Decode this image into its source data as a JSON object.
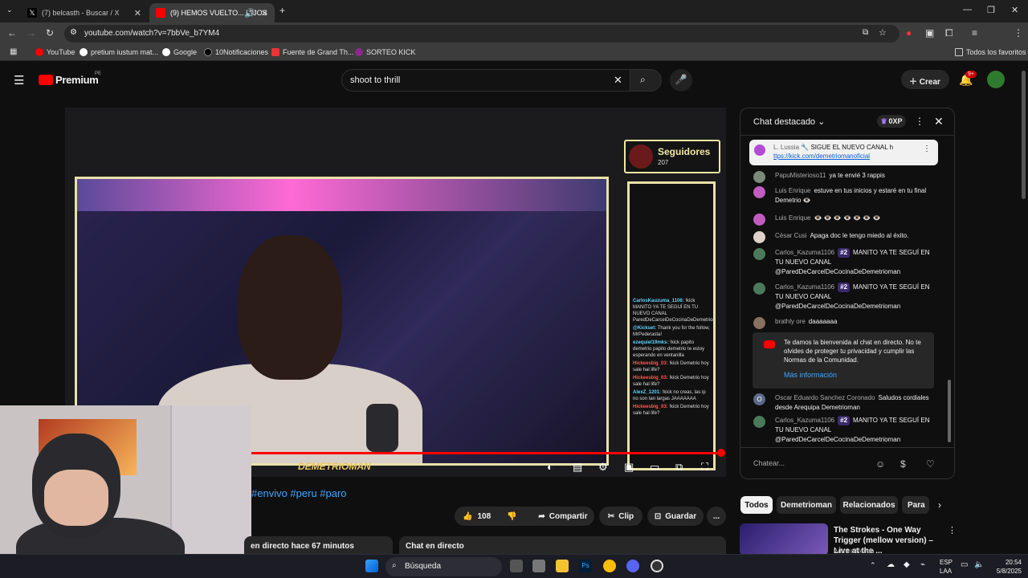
{
  "browser": {
    "tabs": [
      {
        "label": "(7) belcasth - Buscar / X",
        "active": false
      },
      {
        "label": "(9) HEMOS VUELTO... HIJOS",
        "active": true
      }
    ],
    "url": "youtube.com/watch?v=7bbVe_b7YM4",
    "bookmarks": [
      "YouTube",
      "pretium iustum mat...",
      "Google",
      "10Notificaciones",
      "Fuente de Grand Th...",
      "SORTEO KICK"
    ],
    "all_bookmarks": "Todos los favoritos"
  },
  "youtube": {
    "logo": "Premium",
    "logo_region": "PE",
    "search_value": "shoot to thrill",
    "create_label": "Crear",
    "notif_count": "9+"
  },
  "video": {
    "followers_label": "Seguidores",
    "followers_count": "207",
    "overlay_name": "DEMETRIOMAN",
    "mini_chat": [
      {
        "user": "CarlosKauzuma_1106:",
        "text": "!kick MANITO YA TE SEGUÍ EN TU NUEVO CANAL ParedDeCarcelDeCocinaDeDemetrioman"
      },
      {
        "user": "@Kickset:",
        "text": "Thank you for the follow, MrPederasta!"
      },
      {
        "user": "ezequiel19mks:",
        "text": "!kick papito demetrio papito demetrio te estoy esperando en ventanilla"
      },
      {
        "user": "Hickeesbig_03:",
        "text": "!kick Demetrio hoy sale hal life?"
      },
      {
        "user": "Hickeesbig_03:",
        "text": "!kick Demetrio hoy sale hal life?"
      },
      {
        "user": "AlexZ_1201:",
        "text": "!kick no creas, las ip no son tan largas JAAAAAAA"
      },
      {
        "user": "Hickeesbig_03:",
        "text": "!kick Demetrio hoy sale hal life?"
      }
    ]
  },
  "below_video": {
    "tags": "#envivo #peru #paro",
    "likes": "108",
    "share": "Compartir",
    "clip": "Clip",
    "save": "Guardar",
    "more": "...",
    "live_info": "en directo hace 67 minutos",
    "live_chat_card": "Chat en directo"
  },
  "chat": {
    "title": "Chat destacado",
    "xp": "0XP",
    "pinned": {
      "user": "L. Lussia",
      "text": "SIGUE EL NUEVO CANAL h",
      "link": "ttps://kick.com/demetriomanoficial"
    },
    "messages": [
      {
        "user": "PapuMisterioso11",
        "text": "ya te envié 3 rappis",
        "color": "#7a8a7a"
      },
      {
        "user": "Luis Enrique",
        "text": "estuve en tus inicios y estaré en tu final Demetrio 👁️",
        "color": "#c05cc0"
      },
      {
        "user": "Luis Enrique",
        "text": "👁️ 👁️ 👁️ 👁️ 👁️ 👁️ 👁️",
        "color": "#c05cc0"
      },
      {
        "user": "César Cusi",
        "text": "Apaga doc le tengo miedo al éxito.",
        "color": "#e0d0c8"
      },
      {
        "user": "Carlos_Kazuma1106",
        "badge": "#2",
        "text": "MANITO YA TE SEGUÍ EN TU NUEVO CANAL @ParedDeCarcelDeCocinaDeDemetrioman",
        "color": "#4a7a5a"
      },
      {
        "user": "Carlos_Kazuma1106",
        "badge": "#2",
        "text": "MANITO YA TE SEGUÍ EN TU NUEVO CANAL @ParedDeCarcelDeCocinaDeDemetrioman",
        "color": "#4a7a5a"
      },
      {
        "user": "brathly ore",
        "text": "daaaaaaa",
        "color": "#8a7060"
      }
    ],
    "welcome": "Te damos la bienvenida al chat en directo. No te olvides de proteger tu privacidad y cumplir las Normas de la Comunidad.",
    "welcome_more": "Más información",
    "messages_after": [
      {
        "user": "Oscar Eduardo Sanchez Coronado",
        "text": "Saludos cordiales desde Arequipa Demetrioman",
        "color": "#5a6a8a",
        "initial": "O"
      },
      {
        "user": "Carlos_Kazuma1106",
        "badge": "#2",
        "text": "MANITO YA TE SEGUÍ EN TU NUEVO CANAL @ParedDeCarcelDeCocinaDeDemetrioman",
        "color": "#4a7a5a"
      }
    ],
    "input_placeholder": "Chatear..."
  },
  "rail": {
    "chips": [
      "Todos",
      "Demetrioman",
      "Relacionados",
      "Para"
    ],
    "rec_title": "The Strokes - One Way Trigger (mellow version) – Live at the ...",
    "rec_channel": "AdmiralNeeda"
  },
  "taskbar": {
    "search": "Búsqueda",
    "lang1": "ESP",
    "lang2": "LAA",
    "time": "20:54",
    "date": "5/8/2025"
  },
  "colors": {
    "accent_red": "#ff0000",
    "link_blue": "#3ea6ff",
    "overlay_gold": "#e9e2a8"
  }
}
